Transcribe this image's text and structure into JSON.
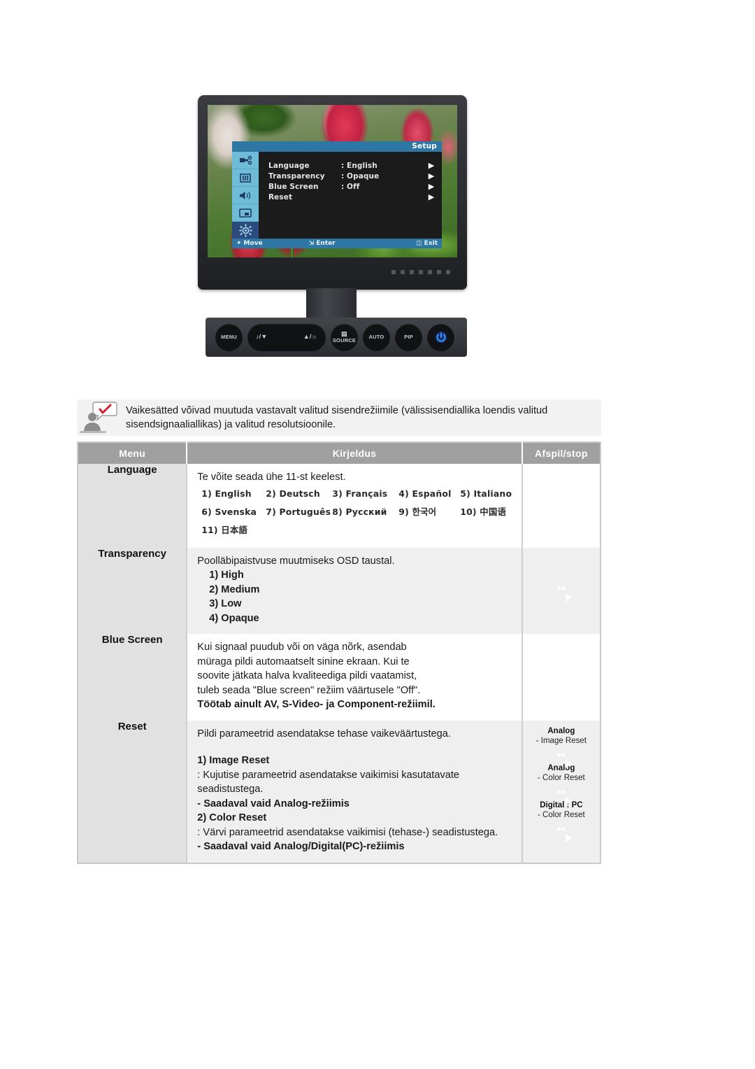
{
  "monitor": {
    "osd": {
      "title": "Setup",
      "sidebar_icons": [
        "input-source-icon",
        "picture-icon",
        "sound-icon",
        "pip-icon",
        "setup-gear-icon"
      ],
      "active_sidebar_index": 4,
      "rows": [
        {
          "label": "Language",
          "value": ": English",
          "arrow": "▶"
        },
        {
          "label": "Transparency",
          "value": ": Opaque",
          "arrow": "▶"
        },
        {
          "label": "Blue Screen",
          "value": ": Off",
          "arrow": "▶"
        },
        {
          "label": "Reset",
          "value": "",
          "arrow": "▶"
        }
      ],
      "footer": {
        "move": "Move",
        "enter": "Enter",
        "exit": "Exit"
      }
    },
    "buttons": [
      {
        "name": "menu-button",
        "label": "MENU"
      },
      {
        "name": "adjust-button",
        "label_left": "♪/▼",
        "label_right": "▲/☼"
      },
      {
        "name": "source-button",
        "label": "SOURCE"
      },
      {
        "name": "auto-button",
        "label": "AUTO"
      },
      {
        "name": "pip-button",
        "label": "PIP"
      },
      {
        "name": "power-button",
        "label": "⏻"
      }
    ]
  },
  "note": {
    "icon": "note-person-icon",
    "text": "Vaikesätted võivad muutuda vastavalt valitud sisendrežiimile (välissisendiallika loendis valitud sisendsignaaliallikas) ja valitud resolutsioonile."
  },
  "table": {
    "headers": {
      "menu": "Menu",
      "description": "Kirjeldus",
      "play_stop": "Afspil/stop"
    },
    "rows": [
      {
        "menu": "Language",
        "intro": "Te võite seada ühe 11-st keelest.",
        "languages_line1": [
          "1) English",
          "2) Deutsch",
          "3) Français",
          "4) Español",
          "5) Italiano"
        ],
        "languages_line2": [
          "6) Svenska",
          "7) Português",
          "8) Русский",
          "9) 한국어",
          "10) 中国语"
        ],
        "languages_line3": [
          "11) 日本語"
        ],
        "play_label": "play-stop-pair"
      },
      {
        "menu": "Transparency",
        "intro": "Poolläbipaistvuse muutmiseks OSD taustal.",
        "options": [
          "1) High",
          "2) Medium",
          "3) Low",
          "4) Opaque"
        ]
      },
      {
        "menu": "Blue Screen",
        "paragraph": "Kui signaal puudub või on väga nõrk, asendab müraga pildi automaatselt sinine ekraan. Kui te soovite jätkata halva kvaliteediga pildi vaatamist, tuleb seada \"Blue screen\" režiim väärtusele \"Off\".",
        "bold_note": "Töötab ainult AV, S-Video- ja Component-režiimil."
      },
      {
        "menu": "Reset",
        "intro": "Pildi parameetrid asendatakse tehase vaikeväärtustega.",
        "item1_title": "1) Image Reset",
        "item1_desc": ": Kujutise parameetrid asendatakse vaikimisi kasutatavate seadistustega.",
        "item1_note": "- Saadaval vaid Analog-režiimis",
        "item2_title": "2) Color Reset",
        "item2_desc": ": Värvi parameetrid asendatakse vaikimisi (tehase-) seadistustega.",
        "item2_note": "- Saadaval vaid Analog/Digital(PC)-režiimis",
        "play_groups": [
          {
            "title": "Analog",
            "sub": "- Image Reset"
          },
          {
            "title": "Analog",
            "sub": "- Color Reset"
          },
          {
            "title": "Digital : PC",
            "sub": "- Color Reset"
          }
        ]
      }
    ]
  },
  "colors": {
    "osd_blue": "#2e77a5",
    "osd_sidebar": "#6fbcd8",
    "osd_active": "#2b4a7e",
    "table_header": "#a0a0a0",
    "menu_cell": "#e1e1e1",
    "shade_row": "#efefef",
    "note_bg": "#f2f2f2",
    "sphere_blue": "#2a8fce"
  }
}
